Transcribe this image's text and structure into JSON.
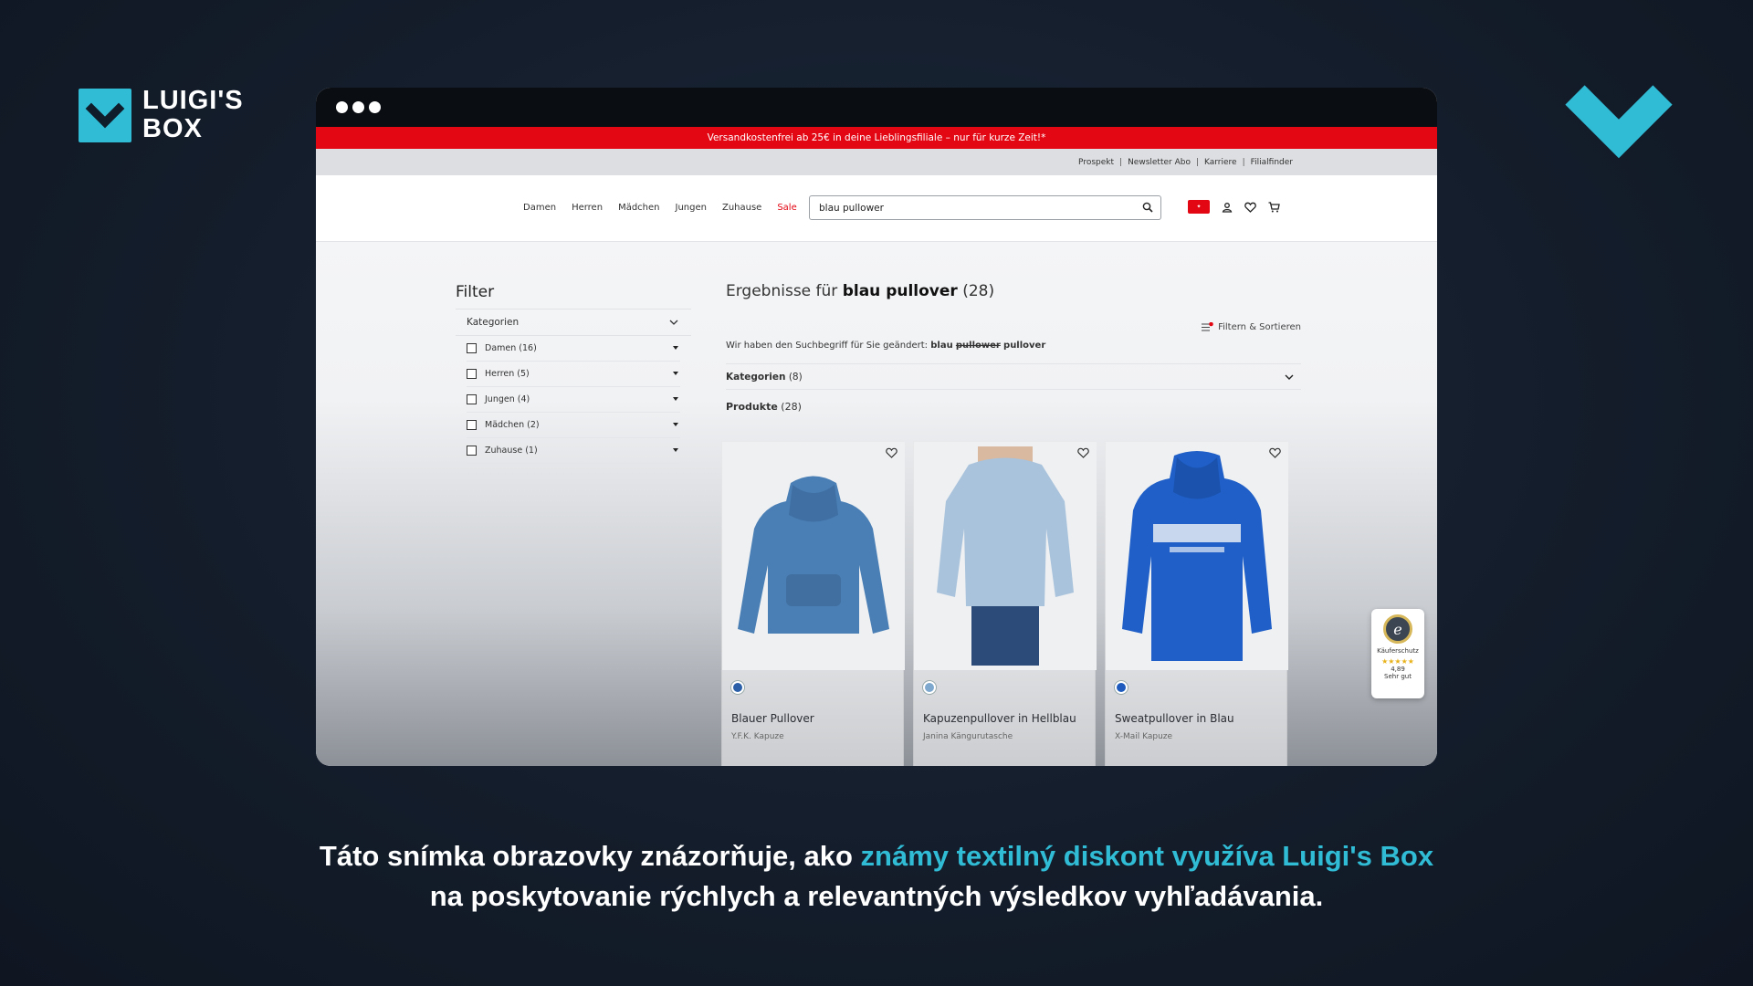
{
  "brand": {
    "logo_line1": "LUIGI'S",
    "logo_line2": "BOX",
    "accent_color": "#31bcd6"
  },
  "browser": {
    "promo_banner": "Versandkostenfrei ab 25€ in deine Lieblingsfiliale – nur für kurze Zeit!*",
    "top_links": [
      "Prospekt",
      "Newsletter Abo",
      "Karriere",
      "Filialfinder"
    ],
    "nav": [
      "Damen",
      "Herren",
      "Mädchen",
      "Jungen",
      "Zuhause",
      "Sale"
    ],
    "search_value": "blau pullower",
    "filter": {
      "title": "Filter",
      "section": "Kategorien",
      "items": [
        {
          "label": "Damen (16)"
        },
        {
          "label": "Herren (5)"
        },
        {
          "label": "Jungen (4)"
        },
        {
          "label": "Mädchen (2)"
        },
        {
          "label": "Zuhause (1)"
        }
      ]
    },
    "results": {
      "prefix": "Ergebnisse für",
      "query": "blau pullover",
      "count": "(28)",
      "filter_sort": "Filtern & Sortieren",
      "changed_text": "Wir haben den Suchbegriff für Sie geändert:",
      "changed_word1": "blau",
      "changed_struck": "pullower",
      "changed_word2": "pullover",
      "categories_label": "Kategorien",
      "categories_count": "(8)",
      "products_label": "Produkte",
      "products_count": "(28)"
    },
    "products": [
      {
        "name": "Blauer Pullover",
        "sub": "Y.F.K. Kapuze",
        "swatch": "#2b5fa8"
      },
      {
        "name": "Kapuzenpullover in Hellblau",
        "sub": "Janina Kängurutasche",
        "swatch": "#7fa8cf"
      },
      {
        "name": "Sweatpullover in Blau",
        "sub": "X-Mail Kapuze",
        "swatch": "#1e5bbd"
      }
    ],
    "trust_badge": {
      "label": "Käuferschutz",
      "rating": "4,89",
      "verdict": "Sehr gut"
    }
  },
  "caption": {
    "part1": "Táto snímka obrazovky znázorňuje, ako ",
    "highlight": "známy textilný diskont využíva Luigi's Box",
    "part2": "na poskytovanie rýchlych a relevantných výsledkov vyhľadávania."
  }
}
